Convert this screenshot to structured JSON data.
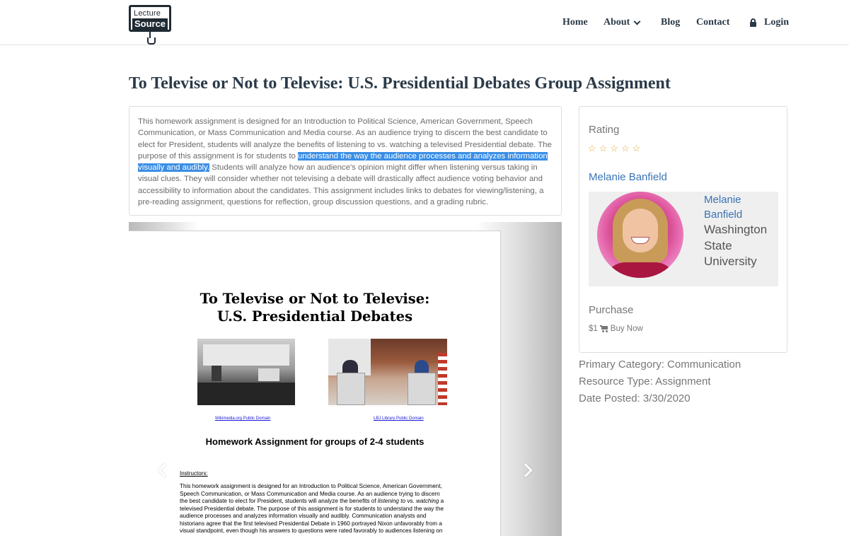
{
  "header": {
    "logo": {
      "line1": "Lecture",
      "line2": "Source"
    },
    "nav": {
      "home": "Home",
      "about": "About",
      "blog": "Blog",
      "contact": "Contact",
      "login": "Login"
    }
  },
  "page": {
    "title": "To Televise or Not to Televise: U.S. Presidential Debates Group Assignment"
  },
  "description": {
    "before": "This homework assignment is designed for an Introduction to Political Science, American Government, Speech Communication, or Mass Communication and Media course. As an audience trying to discern the best candidate to elect for President, students will analyze the benefits of listening to vs. watching a televised Presidential debate. The purpose of this assignment is for students to ",
    "highlighted": "understand the way the audience processes and analyzes information visually and audibly.",
    "after": " Students will analyze how an audience's opinion might differ when listening versus taking in visual clues. They will consider whether not televising a debate will drastically affect audience voting behavior and accessibility to information about the candidates. This assignment includes links to debates for viewing/listening, a pre-reading assignment, questions for reflection, group discussion questions, and a grading rubric."
  },
  "preview": {
    "title_line1": "To Televise or Not to Televise:",
    "title_line2": "U.S. Presidential Debates",
    "caption1": "Wikimedia.org Public Domain",
    "caption2": "LBJ Library Public Domain",
    "hw_title": "Homework Assignment for groups of 2-4 students",
    "instructors_label": "Instructors:",
    "instr_a": "This homework assignment is designed for an Introduction to Political Science, American Government, Speech Communication, or Mass Communication and Media course. As an audience trying to discern the best candidate to elect for President, students will analyze the benefits of ",
    "instr_b": "listening to",
    "instr_c": " vs. ",
    "instr_d": "watching",
    "instr_e": " a televised Presidential debate. The purpose of this assignment is for students to understand the way the audience processes and analyzes information visually and audibly. Communication analysts and historians agree that the first televised Presidential Debate in 1960 portrayed Nixon unfavorably from a visual standpoint, even though his answers to questions were rated favorably to audiences listening on the radio."
  },
  "sidebar": {
    "rating_label": "Rating",
    "stars": "☆☆☆☆☆",
    "author_link": "Melanie Banfield",
    "card_name": "Melanie Banfield",
    "card_org": "Washington State University",
    "purchase_label": "Purchase",
    "price": "$1",
    "buy_label": "Buy Now"
  },
  "meta": {
    "primary_category": "Primary Category: Communication",
    "resource_type": "Resource Type: Assignment",
    "date_posted": "Date Posted: 3/30/2020"
  },
  "colors": {
    "link": "#3a73b5",
    "highlight": "#3a8ee6",
    "nav": "#2b3a48"
  },
  "icons": [
    "chevron-down-icon",
    "lock-icon",
    "star-icon",
    "cart-icon",
    "arrow-left-icon",
    "arrow-right-icon"
  ]
}
